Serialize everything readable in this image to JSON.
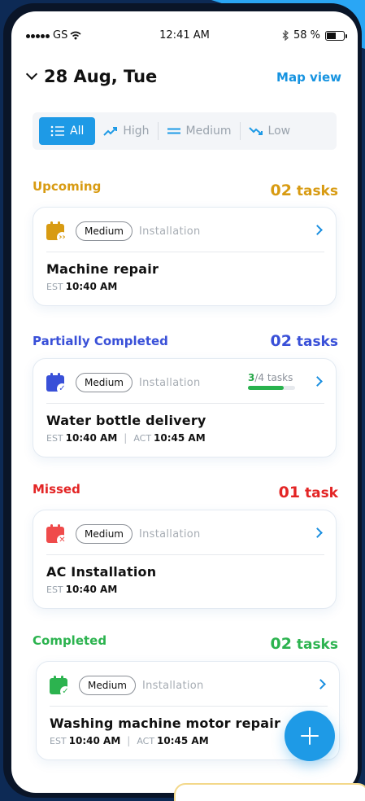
{
  "status_bar": {
    "carrier": "GS",
    "time": "12:41 AM",
    "battery": "58 %",
    "battery_level": 0.58
  },
  "header": {
    "date": "28 Aug, Tue",
    "map_view_label": "Map view"
  },
  "filters": [
    {
      "label": "All",
      "icon": "list-icon",
      "active": true
    },
    {
      "label": "High",
      "icon": "trend-up-icon",
      "active": false
    },
    {
      "label": "Medium",
      "icon": "equals-icon",
      "active": false
    },
    {
      "label": "Low",
      "icon": "trend-down-icon",
      "active": false
    }
  ],
  "sections": [
    {
      "title": "Upcoming",
      "count_num": "02",
      "count_unit": "tasks",
      "color": "#d89b12",
      "task": {
        "priority": "Medium",
        "category": "Installation",
        "title": "Machine repair",
        "est_label": "EST",
        "est_time": "10:40 AM"
      }
    },
    {
      "title": "Partially Completed",
      "count_num": "02",
      "count_unit": "tasks",
      "color": "#3950d8",
      "task": {
        "priority": "Medium",
        "category": "Installation",
        "title": "Water bottle delivery",
        "est_label": "EST",
        "est_time": "10:40 AM",
        "act_label": "ACT",
        "act_time": "10:45 AM",
        "progress_done": "3",
        "progress_total": "/4 tasks",
        "progress_fraction": 0.75
      }
    },
    {
      "title": "Missed",
      "count_num": "01",
      "count_unit": "task",
      "color": "#e32525",
      "task": {
        "priority": "Medium",
        "category": "Installation",
        "title": "AC Installation",
        "est_label": "EST",
        "est_time": "10:40 AM"
      }
    },
    {
      "title": "Completed",
      "count_num": "02",
      "count_unit": "tasks",
      "color": "#2cb34f",
      "task": {
        "priority": "Medium",
        "category": "Installation",
        "title": "Washing machine motor repair",
        "est_label": "EST",
        "est_time": "10:40 AM",
        "act_label": "ACT",
        "act_time": "10:45 AM"
      }
    }
  ],
  "colors": {
    "accent": "#1e9ae6",
    "calendar_upcoming": "#d89b12",
    "calendar_partial": "#3950d8",
    "calendar_missed": "#ef4b4b",
    "calendar_completed": "#2cb34f"
  }
}
